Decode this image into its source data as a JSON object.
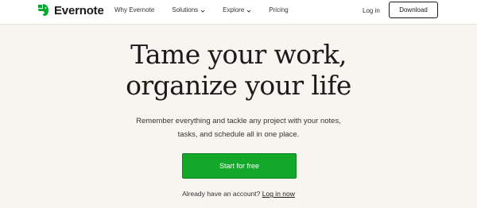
{
  "brand": {
    "name": "Evernote",
    "color": "#00a82d",
    "icon": "elephant-logo-icon"
  },
  "nav": {
    "links": [
      {
        "label": "Why Evernote",
        "has_dropdown": false
      },
      {
        "label": "Solutions",
        "has_dropdown": true
      },
      {
        "label": "Explore",
        "has_dropdown": true
      },
      {
        "label": "Pricing",
        "has_dropdown": false
      }
    ],
    "login_label": "Log in",
    "download_label": "Download"
  },
  "hero": {
    "headline_line1": "Tame your work,",
    "headline_line2": "organize your life",
    "subtext_line1": "Remember everything and tackle any project with your notes,",
    "subtext_line2": "tasks, and schedule all in one place.",
    "cta_label": "Start for free",
    "cta_color": "#14a82b",
    "already_text": "Already have an account?",
    "login_link": "Log in now"
  }
}
